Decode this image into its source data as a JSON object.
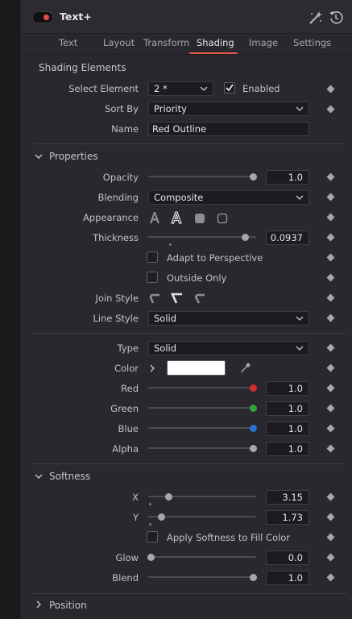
{
  "header": {
    "title": "Text+"
  },
  "tabs": [
    "Text",
    "Layout",
    "Transform",
    "Shading",
    "Image",
    "Settings"
  ],
  "shading_elements": {
    "heading": "Shading Elements",
    "select_element_label": "Select Element",
    "select_element_value": "2 *",
    "enabled_label": "Enabled",
    "enabled": true,
    "sort_by_label": "Sort By",
    "sort_by_value": "Priority",
    "name_label": "Name",
    "name_value": "Red Outline"
  },
  "properties": {
    "heading": "Properties",
    "opacity_label": "Opacity",
    "opacity_value": "1.0",
    "opacity_level": 1.0,
    "blending_label": "Blending",
    "blending_value": "Composite",
    "appearance_label": "Appearance",
    "appearance_options": [
      "text-solid-icon",
      "text-outline-icon",
      "rect-solid-icon",
      "rect-outline-icon"
    ],
    "thickness_label": "Thickness",
    "thickness_value": "0.0937",
    "thickness_level": 0.92,
    "adapt_label": "Adapt to Perspective",
    "adapt_checked": false,
    "outside_label": "Outside Only",
    "outside_checked": false,
    "join_style_label": "Join Style",
    "line_style_label": "Line Style",
    "line_style_value": "Solid"
  },
  "fill": {
    "type_label": "Type",
    "type_value": "Solid",
    "color_label": "Color",
    "color_hex": "#ffffff",
    "red_label": "Red",
    "red_value": "1.0",
    "red_color": "#d42b2b",
    "green_label": "Green",
    "green_value": "1.0",
    "green_color": "#34a23a",
    "blue_label": "Blue",
    "blue_value": "1.0",
    "blue_color": "#2b6fd0",
    "alpha_label": "Alpha",
    "alpha_value": "1.0"
  },
  "softness": {
    "heading": "Softness",
    "x_label": "X",
    "x_value": "3.15",
    "x_level": 0.17,
    "y_label": "Y",
    "y_value": "1.73",
    "y_level": 0.1,
    "apply_label": "Apply Softness to Fill Color",
    "apply_checked": false,
    "glow_label": "Glow",
    "glow_value": "0.0",
    "glow_level": 0.0,
    "blend_label": "Blend",
    "blend_value": "1.0",
    "blend_level": 1.0
  },
  "position": {
    "heading": "Position"
  }
}
